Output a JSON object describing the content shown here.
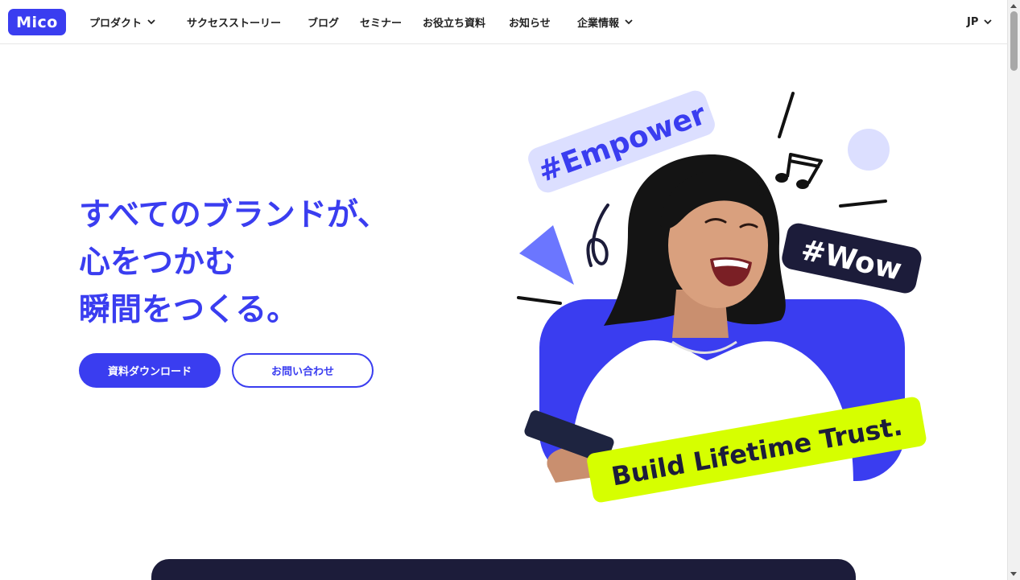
{
  "header": {
    "logo": "Mico",
    "nav": [
      {
        "label": "プロダクト",
        "has_dropdown": true
      },
      {
        "label": "サクセスストーリー",
        "has_dropdown": false
      },
      {
        "label": "ブログ",
        "has_dropdown": false
      },
      {
        "label": "セミナー",
        "has_dropdown": false
      },
      {
        "label": "お役立ち資料",
        "has_dropdown": false
      },
      {
        "label": "お知らせ",
        "has_dropdown": false
      },
      {
        "label": "企業情報",
        "has_dropdown": true
      }
    ],
    "language": "JP"
  },
  "hero": {
    "headline": [
      "すべてのブランドが、",
      "心をつかむ",
      "瞬間をつくる。"
    ],
    "primary_button": "資料ダウンロード",
    "secondary_button": "お問い合わせ",
    "art": {
      "tag_empower": "#Empower",
      "tag_wow": "#Wow",
      "banner": "Build Lifetime Trust."
    }
  },
  "colors": {
    "brand": "#3a3df0",
    "navy": "#1c1c3a",
    "lime": "#d6ff00",
    "lavender": "#dcdfff"
  },
  "icons": [
    "chevron-down-icon",
    "music-note-icon",
    "portrait-photo"
  ]
}
